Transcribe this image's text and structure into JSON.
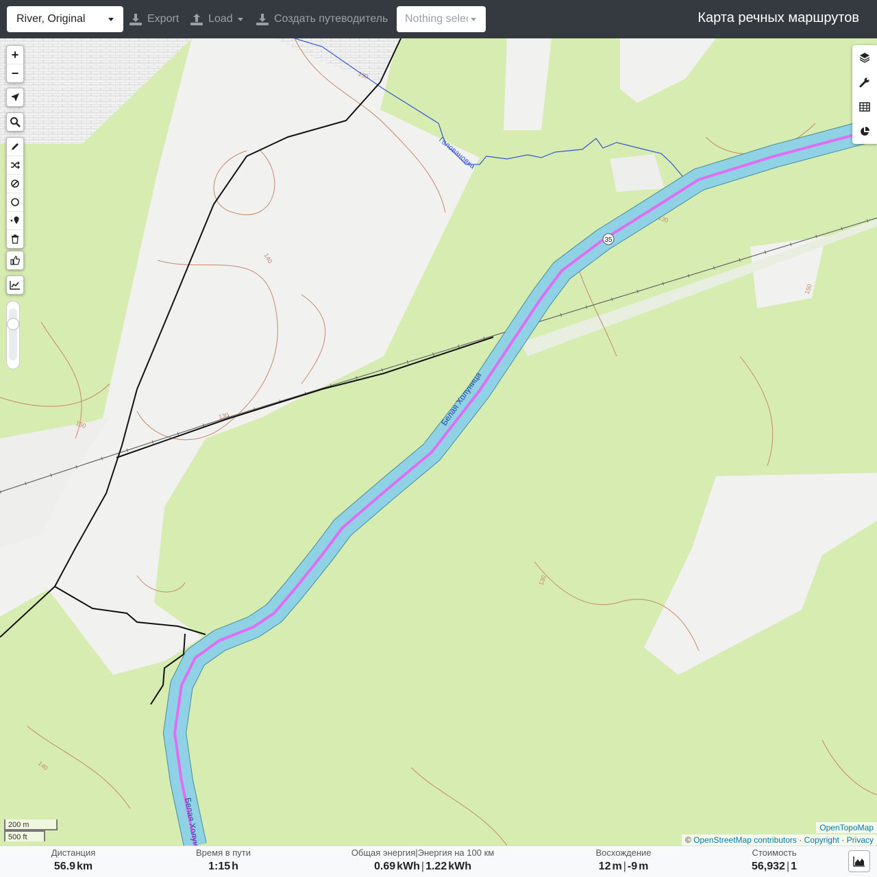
{
  "header": {
    "profile_select": "River, Original",
    "export_label": "Export",
    "load_label": "Load",
    "guide_label": "Создать путеводитель",
    "nothing_select": "Nothing selected",
    "title": "Карта речных маршрутов"
  },
  "map": {
    "river_label": "Белая Холуница",
    "river_label_bottom": "Белая Холуница",
    "stream_label": "Головановка",
    "route_marker": "35",
    "contour_labels": [
      "130",
      "140",
      "150"
    ],
    "scale_metric": "200 m",
    "scale_imperial": "500 ft",
    "attribution_top": "OpenTopoMap",
    "attribution_copy": "©",
    "attribution_osm": "OpenStreetMap contributors",
    "attribution_sep": "·",
    "attribution_copyright": "Copyright",
    "attribution_privacy": "Privacy"
  },
  "left_controls": {
    "zoom_in": "+",
    "zoom_out": "−"
  },
  "stats": {
    "distance_label": "Дистанция",
    "distance_value": "56.9",
    "distance_unit": "km",
    "time_label": "Время в пути",
    "time_value": "1:15",
    "time_unit": "h",
    "energy_label": "Общая энергия|Энергия на 100 км",
    "energy_total": "0.69",
    "energy_total_unit": "kWh",
    "energy_sep": "|",
    "energy_per100": "1.22",
    "energy_per100_unit": "kWh",
    "ascent_label": "Восхождение",
    "ascent_up": "12",
    "ascent_up_unit": "m",
    "ascent_sep": "|",
    "ascent_down": "-9",
    "ascent_down_unit": "m",
    "cost_label": "Стоимость",
    "cost_value": "56,932",
    "cost_sep": "|",
    "cost_count": "1"
  },
  "colors": {
    "topbar": "#343a40",
    "forest": "#d6ecb0",
    "open_land": "#f1f1ef",
    "water": "#8fd2e6",
    "route": "#e06ef2",
    "contour": "#c8866a",
    "stream": "#3557d0",
    "road": "#111111"
  }
}
